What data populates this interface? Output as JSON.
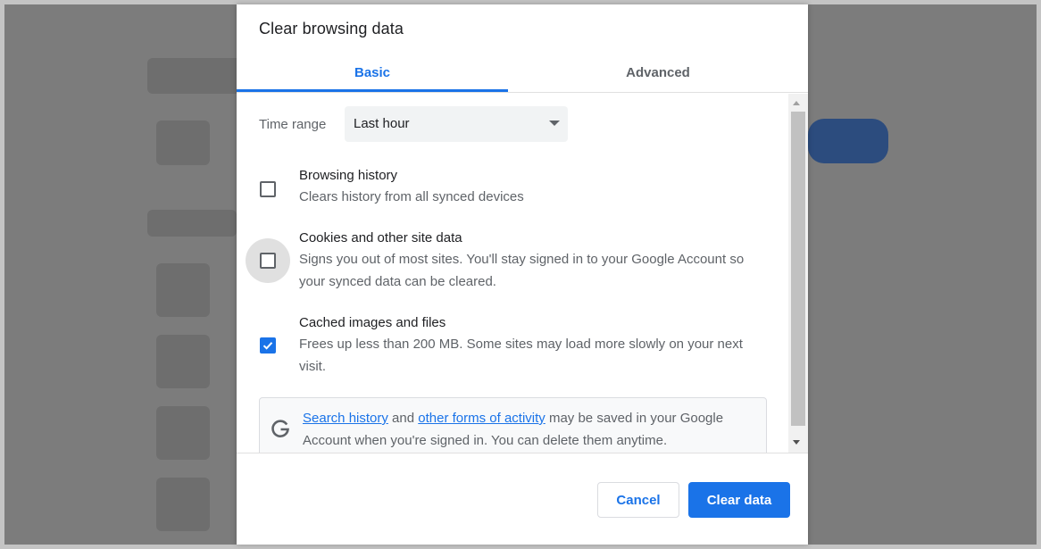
{
  "dialog": {
    "title": "Clear browsing data",
    "tabs": [
      {
        "label": "Basic",
        "active": true
      },
      {
        "label": "Advanced",
        "active": false
      }
    ],
    "time_range": {
      "label": "Time range",
      "value": "Last hour"
    },
    "options": [
      {
        "title": "Browsing history",
        "description": "Clears history from all synced devices",
        "checked": false
      },
      {
        "title": "Cookies and other site data",
        "description": "Signs you out of most sites. You'll stay signed in to your Google Account so your synced data can be cleared.",
        "checked": false
      },
      {
        "title": "Cached images and files",
        "description": "Frees up less than 200 MB. Some sites may load more slowly on your next visit.",
        "checked": true
      }
    ],
    "info": {
      "icon": "google-g-icon",
      "link1": "Search history",
      "text1": " and ",
      "link2": "other forms of activity",
      "text2": " may be saved in your Google Account when you're signed in. You can delete them anytime."
    },
    "buttons": {
      "cancel": "Cancel",
      "clear": "Clear data"
    }
  },
  "colors": {
    "accent": "#1a73e8",
    "overlay": "#7c7c7c"
  }
}
